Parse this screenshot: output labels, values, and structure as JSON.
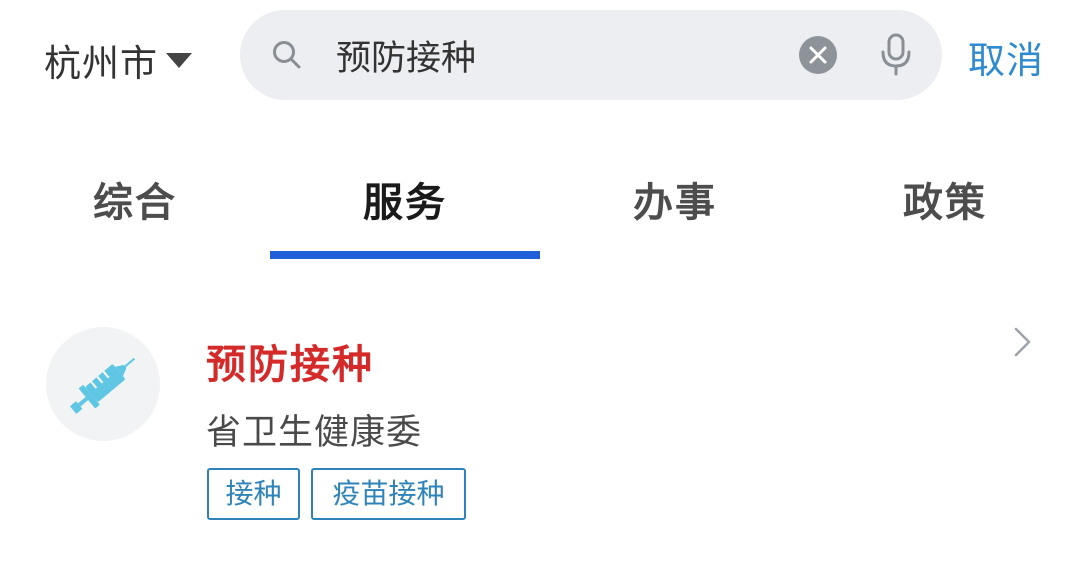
{
  "header": {
    "city": "杭州市",
    "search": {
      "value": "预防接种",
      "icon": "search-icon",
      "clear_icon": "clear-icon",
      "voice_icon": "mic-icon"
    },
    "cancel_label": "取消"
  },
  "tabs": [
    {
      "label": "综合",
      "active": false
    },
    {
      "label": "服务",
      "active": true
    },
    {
      "label": "办事",
      "active": false
    },
    {
      "label": "政策",
      "active": false
    }
  ],
  "results": [
    {
      "icon": "syringe-icon",
      "title": "预防接种",
      "subtitle": "省卫生健康委",
      "tags": [
        "接种",
        "疫苗接种"
      ]
    }
  ],
  "colors": {
    "accent": "#2e8ad1",
    "tab_indicator": "#1f5fd8",
    "title_highlight": "#d42a2a",
    "tag": "#2e84b8",
    "search_bg": "#eceef1",
    "icon_syringe": "#5fc7e3"
  }
}
